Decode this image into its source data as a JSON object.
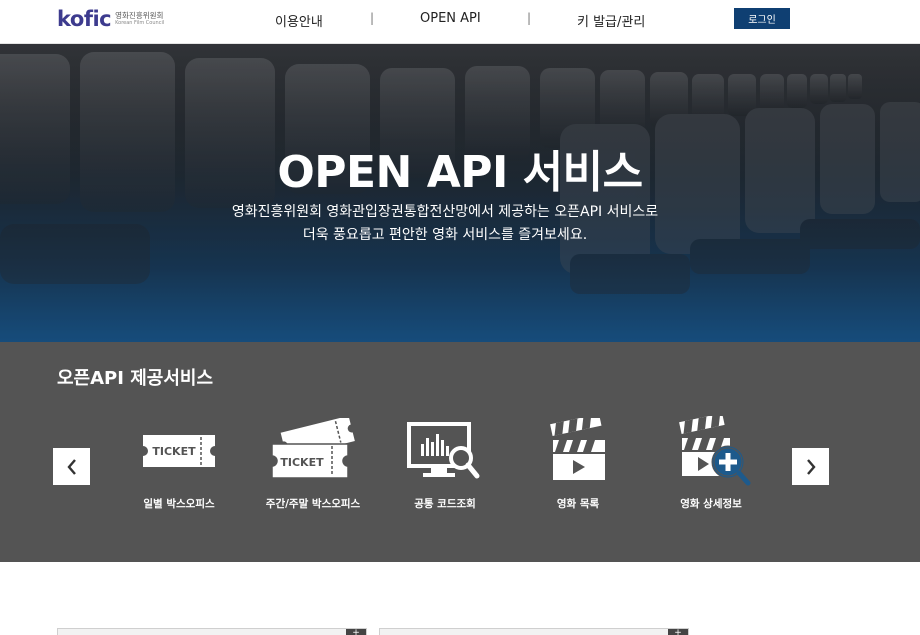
{
  "header": {
    "logo_text": "kofic",
    "logo_kr": "영화진흥위원회",
    "logo_en": "Korean Film Council",
    "nav": [
      "이용안내",
      "OPEN API",
      "키 발급/관리"
    ],
    "separator": "|",
    "login_label": "로그인"
  },
  "hero": {
    "title": "OPEN API 서비스",
    "desc_line1": "영화진흥위원회 영화관입장권통합전산망에서 제공하는 오픈API 서비스로",
    "desc_line2": "더욱 풍요롭고 편안한 영화 서비스를 즐겨보세요."
  },
  "services": {
    "title": "오픈API 제공서비스",
    "prev_glyph": "‹",
    "next_glyph": "›",
    "items": [
      {
        "label": "일별 박스오피스",
        "icon": "ticket-icon",
        "ticket_text": "TICKET"
      },
      {
        "label": "주간/주말 박스오피스",
        "icon": "tickets-icon",
        "ticket_text": "TICKET"
      },
      {
        "label": "공통 코드조회",
        "icon": "monitor-search-icon"
      },
      {
        "label": "영화 목록",
        "icon": "clapperboard-icon"
      },
      {
        "label": "영화 상세정보",
        "icon": "clapperboard-zoom-icon"
      }
    ]
  },
  "panels": {
    "corner_glyph": "+"
  },
  "colors": {
    "brand": "#3d3b8e",
    "login_bg": "#0f3f72",
    "services_bg": "#545454"
  }
}
